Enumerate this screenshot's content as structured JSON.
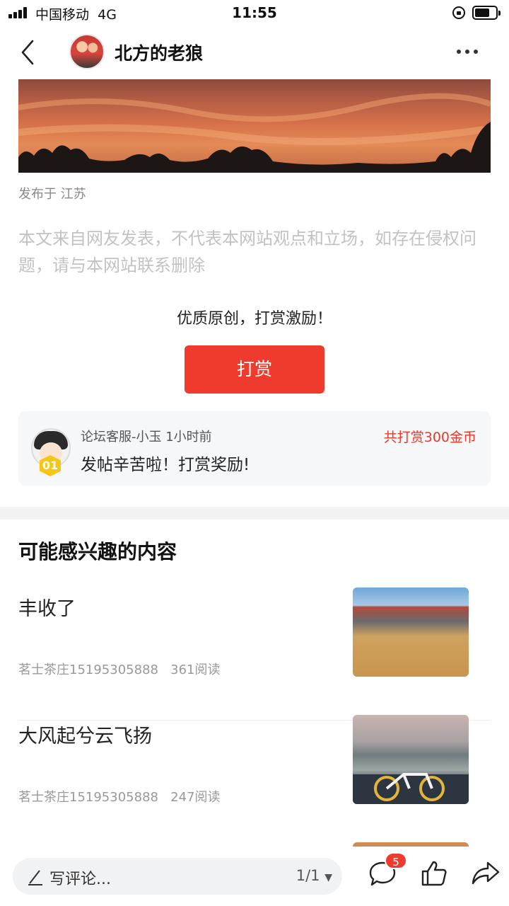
{
  "status_bar": {
    "carrier": "中国移动",
    "network": "4G",
    "time": "11:55"
  },
  "nav": {
    "author_name": "北方的老狼",
    "back_icon": "chevron-left-icon",
    "more_icon": "more-horizontal-icon"
  },
  "post": {
    "location": "发布于 江苏",
    "disclaimer": "本文来自网友发表，不代表本网站观点和立场，如存在侵权问题，请与本网站联系删除"
  },
  "reward": {
    "prompt": "优质原创，打赏激励！",
    "button_label": "打赏",
    "card": {
      "badge": "01",
      "giver": "论坛客服-小玉",
      "time": "1小时前",
      "total": "共打赏300金币",
      "message": "发帖辛苦啦！打赏奖励!"
    }
  },
  "recommend": {
    "title": "可能感兴趣的内容",
    "items": [
      {
        "title": "丰收了",
        "source": "茗士茶庄15195305888",
        "reads": "361阅读"
      },
      {
        "title": "大风起兮云飞扬",
        "source": "茗士茶庄15195305888",
        "reads": "247阅读"
      }
    ]
  },
  "bottom_bar": {
    "comment_placeholder": "写评论...",
    "page_indicator": "1/1",
    "comment_count": "5",
    "icons": [
      "pen-icon",
      "comment-icon",
      "like-icon",
      "share-icon"
    ]
  },
  "colors": {
    "accent_red": "#ef3b2d",
    "reward_total_red": "#e8382c",
    "disclaimer_gray": "#c2c2c2"
  }
}
